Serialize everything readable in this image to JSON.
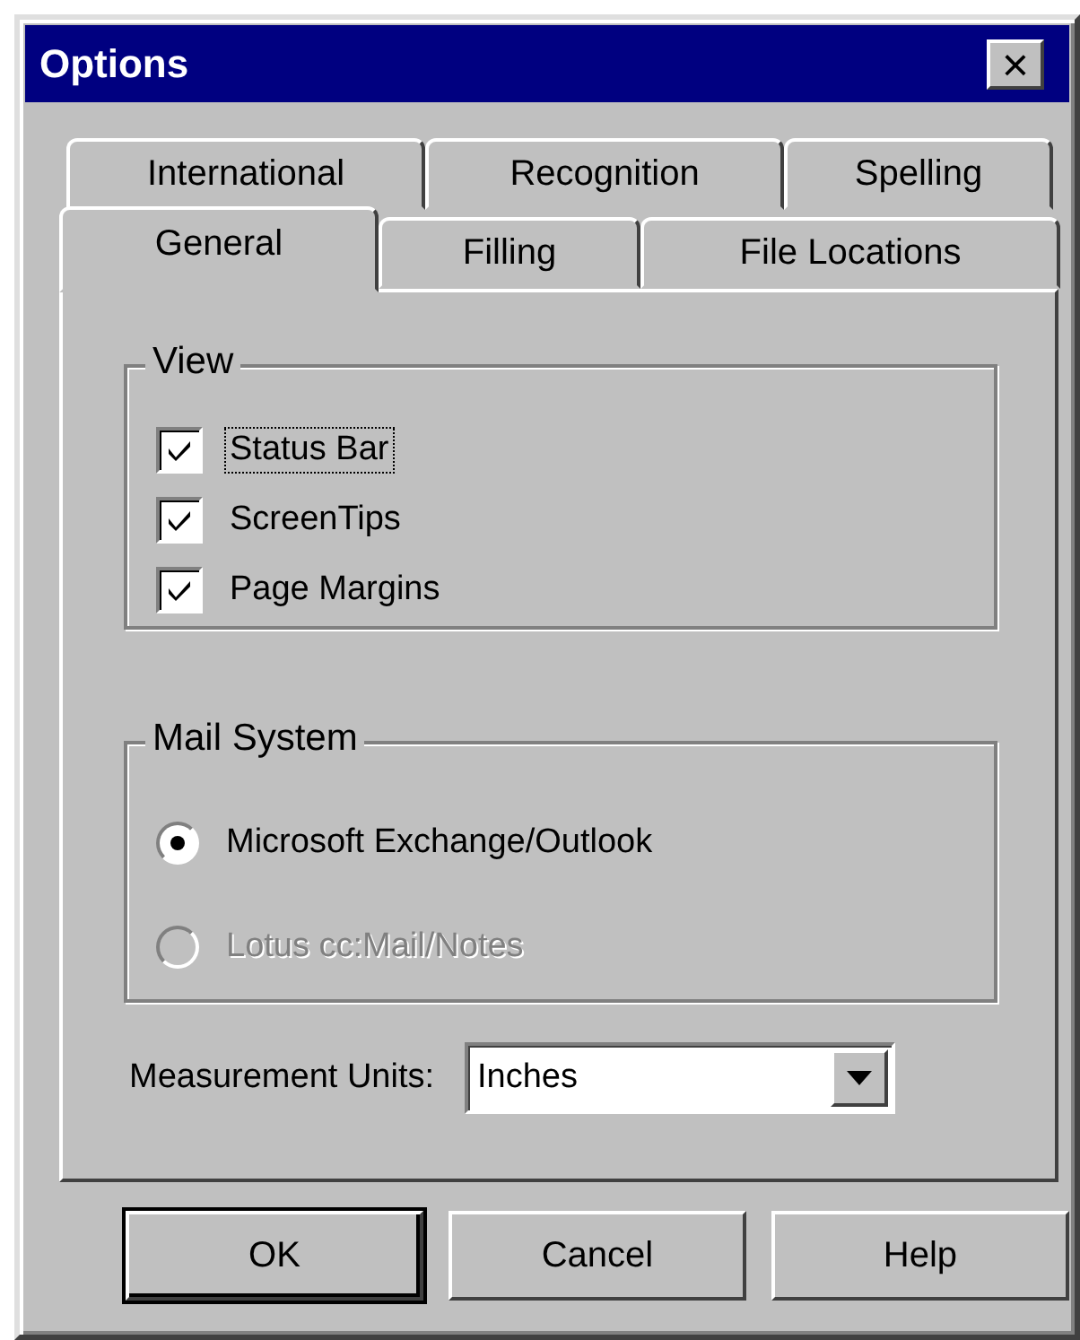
{
  "window": {
    "title": "Options",
    "close": "×"
  },
  "tab_rows": [
    [
      {
        "label": "International",
        "selected": false
      },
      {
        "label": "Recognition",
        "selected": false
      },
      {
        "label": "Spelling",
        "selected": false
      }
    ],
    [
      {
        "label": "General",
        "selected": true
      },
      {
        "label": "Filling",
        "selected": false
      },
      {
        "label": "File Locations",
        "selected": false
      }
    ]
  ],
  "view": {
    "title": "View",
    "items": [
      {
        "label": "Status Bar",
        "checked": true,
        "focused": true
      },
      {
        "label": "ScreenTips",
        "checked": true,
        "focused": false
      },
      {
        "label": "Page Margins",
        "checked": true,
        "focused": false
      }
    ]
  },
  "mail_system": {
    "title": "Mail System",
    "options": [
      {
        "label": "Microsoft Exchange/Outlook",
        "selected": true,
        "disabled": false
      },
      {
        "label": "Lotus cc:Mail/Notes",
        "selected": false,
        "disabled": true
      }
    ]
  },
  "measurement": {
    "label": "Measurement Units:",
    "value": "Inches"
  },
  "buttons": [
    {
      "label": "OK",
      "default": true
    },
    {
      "label": "Cancel",
      "default": false
    },
    {
      "label": "Help",
      "default": false
    }
  ]
}
